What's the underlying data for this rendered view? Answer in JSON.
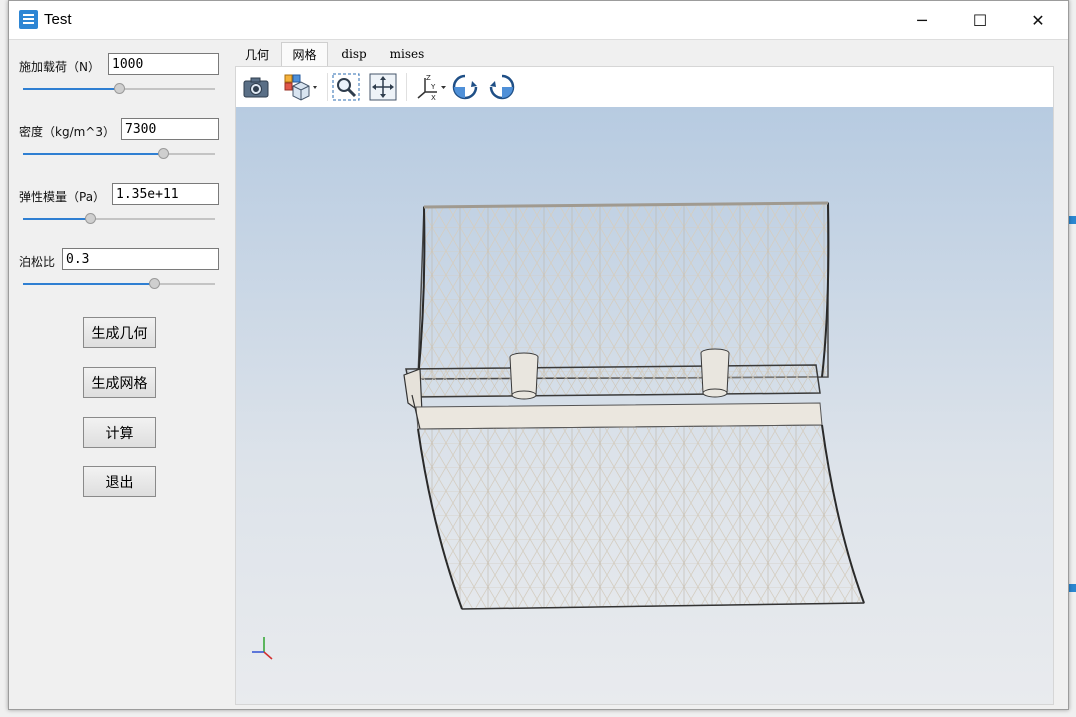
{
  "window": {
    "title": "Test",
    "controls": {
      "minimize": "─",
      "maximize": "☐",
      "close": "✕"
    }
  },
  "params": [
    {
      "label": "施加载荷（N）",
      "value": "1000",
      "slider_fraction": 0.5
    },
    {
      "label": "密度（kg/m^3）",
      "value": "7300",
      "slider_fraction": 0.73
    },
    {
      "label": "弹性模量（Pa）",
      "value": "1.35e+11",
      "slider_fraction": 0.35
    },
    {
      "label": "泊松比",
      "value": "0.3",
      "slider_fraction": 0.68
    }
  ],
  "buttons": {
    "generate_geometry": "生成几何",
    "generate_mesh": "生成网格",
    "compute": "计算",
    "exit": "退出"
  },
  "tabs": [
    {
      "label": "几何",
      "active": false
    },
    {
      "label": "网格",
      "active": true
    },
    {
      "label": "disp",
      "active": false
    },
    {
      "label": "mises",
      "active": false
    }
  ],
  "toolbar": [
    {
      "icon": "camera-icon"
    },
    {
      "icon": "view-cube-dropdown-icon"
    },
    {
      "icon": "zoom-box-icon"
    },
    {
      "icon": "fit-all-icon"
    },
    {
      "icon": "axes-dropdown-icon"
    },
    {
      "icon": "rotate-left-icon"
    },
    {
      "icon": "rotate-right-icon"
    }
  ],
  "colors": {
    "accent": "#2f7fd2",
    "scene_top": "#b7cbe1",
    "scene_bottom": "#e9ebee",
    "mesh_light": "#d6cfc3",
    "mesh_dark": "#3a3a3a"
  }
}
